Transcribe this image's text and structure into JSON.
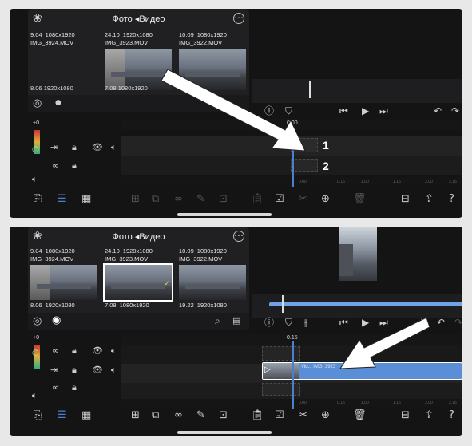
{
  "browser": {
    "title": "Фото ◂Видео",
    "tiles_top": [
      {
        "duration": "9.04",
        "resolution": "1080x1920",
        "name": "IMG_3924.MOV"
      },
      {
        "duration": "24.10",
        "resolution": "1920x1080",
        "name": "IMG_3923.MOV"
      },
      {
        "duration": "10.09",
        "resolution": "1080x1920",
        "name": "IMG_3922.MOV"
      }
    ],
    "tiles_bottom_s1": [
      {
        "duration": "8.06",
        "resolution": "1920x1080"
      },
      {
        "duration": "7.08",
        "resolution": "1080x1920"
      },
      {
        "duration": "",
        "resolution": ""
      }
    ],
    "tiles_bottom_s2": [
      {
        "duration": "8.06",
        "resolution": "1920x1080"
      },
      {
        "duration": "7.08",
        "resolution": "1080x1920"
      },
      {
        "duration": "19.22",
        "resolution": "1920x1080"
      }
    ]
  },
  "timeline": {
    "s1_time": "0.00",
    "s2_time": "0.15",
    "track_level": "+0",
    "ruler": [
      "0.00",
      "0.15",
      "1.00",
      "1.15",
      "2.00",
      "2.15"
    ],
    "clip_label": "Vid... IMG_3923"
  },
  "annotations": {
    "label1": "1",
    "label2": "2"
  },
  "colors": {
    "background": "#141414",
    "accent": "#4b7fd0",
    "clip": "#5a8fd8",
    "arrow": "#ffffff"
  },
  "icons": {
    "settings": "flower-icon",
    "more": "ellipsis-circle-icon",
    "select": "checkmark-circle-icon",
    "record": "record-icon",
    "search": "search-icon",
    "info": "info-icon",
    "play": "play-icon",
    "skip_start": "skip-back-icon",
    "skip_end": "skip-forward-icon",
    "undo": "undo-icon",
    "redo": "redo-icon",
    "split": "scissors-icon",
    "add": "plus-circle-icon",
    "delete": "trash-icon",
    "share": "share-icon",
    "help": "help-icon"
  }
}
